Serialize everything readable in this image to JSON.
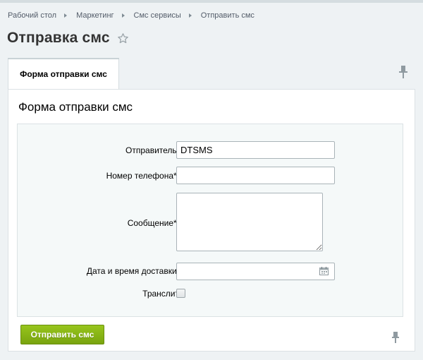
{
  "breadcrumb": [
    {
      "label": "Рабочий стол"
    },
    {
      "label": "Маркетинг"
    },
    {
      "label": "Смс сервисы"
    },
    {
      "label": "Отправить смс"
    }
  ],
  "page": {
    "title": "Отправка смс"
  },
  "tabs": [
    {
      "label": "Форма отправки смс",
      "active": true
    }
  ],
  "form": {
    "title": "Форма отправки смс",
    "sender": {
      "label": "Отправитель:",
      "value": "DTSMS"
    },
    "phone": {
      "label": "Номер телефона*:",
      "value": ""
    },
    "message": {
      "label": "Сообщение*:",
      "value": ""
    },
    "delivery": {
      "label": "Дата и время доставки:",
      "value": ""
    },
    "translit": {
      "label": "Транслит",
      "checked": false
    }
  },
  "actions": {
    "send_label": "Отправить смс"
  },
  "colors": {
    "accent": "#86b516",
    "background": "#eef2f4",
    "link": "#535c69"
  },
  "icons": [
    "star-icon",
    "pin-icon",
    "calendar-icon",
    "chevron-right-icon"
  ]
}
